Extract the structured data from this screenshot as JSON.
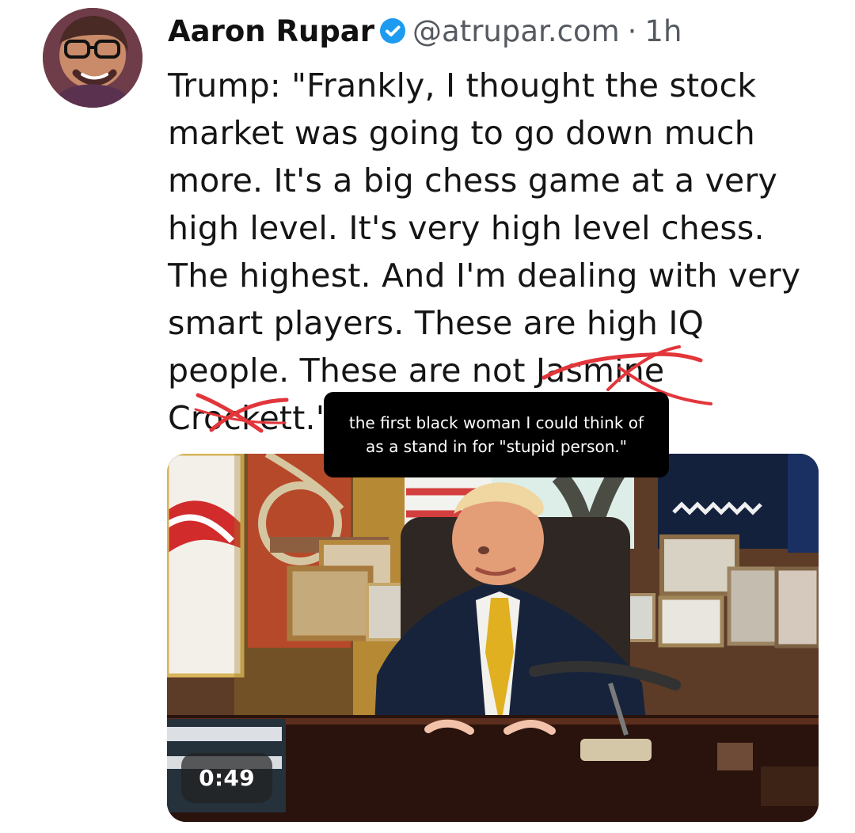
{
  "post": {
    "author_name": "Aaron Rupar",
    "handle": "@atrupar.com",
    "separator": "·",
    "time": "1h",
    "text": "Trump: \"Frankly, I thought the stock market was going to go down much more. It's a big chess game at a very high level. It's very high level chess. The highest. And I'm dealing with very smart players. These are high IQ people. These are not Jasmine Crockett.\""
  },
  "annotation": {
    "line_1": "the first black woman I could think of",
    "line_2": "as a stand in for \"stupid person.\""
  },
  "media": {
    "duration": "0:49"
  },
  "icons": {
    "verified": "verified-check-icon"
  },
  "colors": {
    "verified_badge": "#1d9bf0",
    "scribble": "#e2363b"
  }
}
